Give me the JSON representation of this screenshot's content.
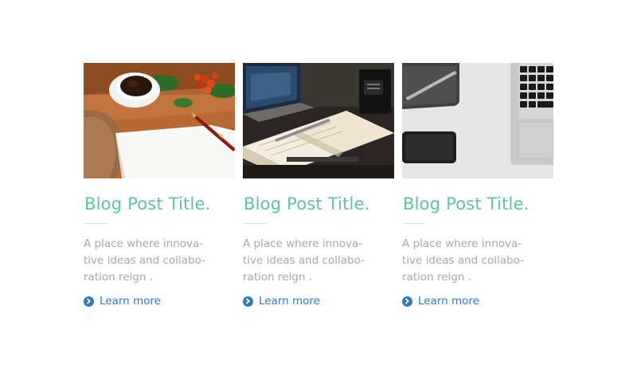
{
  "posts": [
    {
      "image": "coffee-notepad-photo",
      "title": "Blog Post Title.",
      "excerpt_lines": [
        "A place where innova-",
        "tive ideas and collabo-",
        "ration reign ."
      ],
      "link_label": "Learn more",
      "link_icon": "chevron-circle-right-icon"
    },
    {
      "image": "open-notebook-photo",
      "title": "Blog Post Title.",
      "excerpt_lines": [
        "A place where innova-",
        "tive ideas and collabo-",
        "ration reign ."
      ],
      "link_label": "Learn more",
      "link_icon": "chevron-circle-right-icon"
    },
    {
      "image": "laptop-phone-desk-photo",
      "title": "Blog Post Title.",
      "excerpt_lines": [
        "A place where innova-",
        "tive ideas and collabo-",
        "ration reign ."
      ],
      "link_label": "Learn more",
      "link_icon": "chevron-circle-right-icon"
    }
  ],
  "colors": {
    "title": "#5ec2a8",
    "excerpt": "#a8a8a8",
    "link": "#2e7bbf",
    "divider": "#dcdcdc"
  }
}
